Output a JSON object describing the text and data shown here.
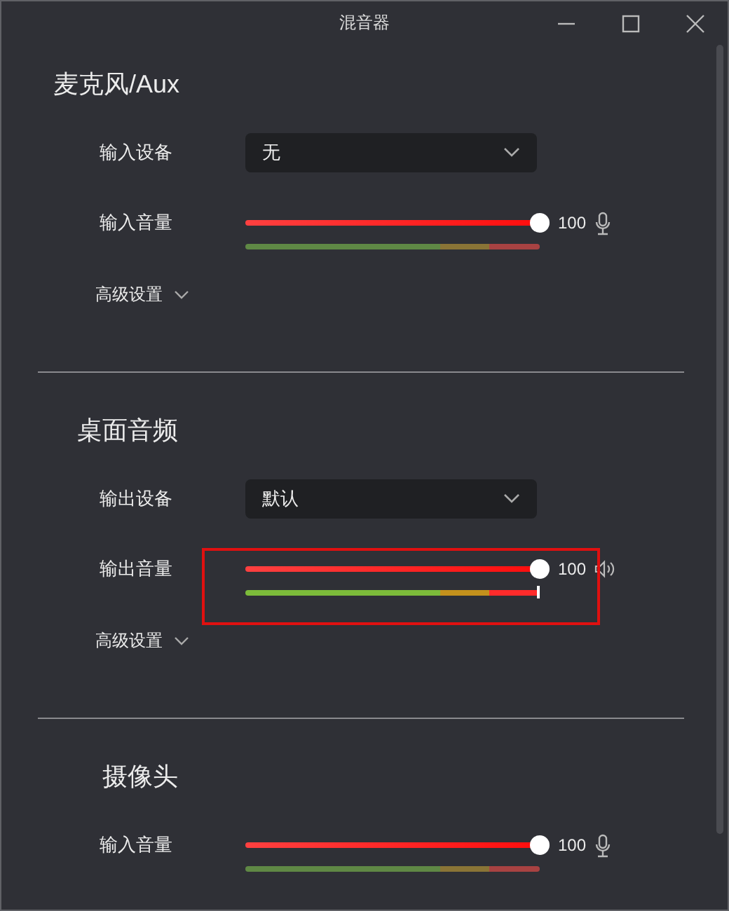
{
  "window": {
    "title": "混音器"
  },
  "sections": [
    {
      "title": "麦克风/Aux",
      "rows": [
        {
          "kind": "dropdown",
          "label": "输入设备",
          "value": "无"
        },
        {
          "kind": "input_volume",
          "label": "输入音量",
          "level": 1,
          "reading": "100",
          "meter_active": false,
          "highlighted": false
        }
      ],
      "advanced": {
        "label": "高级设置",
        "expanded": false
      }
    },
    {
      "title": "桌面音频",
      "rows": [
        {
          "kind": "dropdown",
          "label": "输出设备",
          "value": "默认"
        },
        {
          "kind": "output_volume",
          "label": "输出音量",
          "level": 1,
          "reading": "100",
          "meter_active": true,
          "highlighted": true
        }
      ],
      "advanced": {
        "label": "高级设置",
        "expanded": false
      }
    },
    {
      "title": "摄像头",
      "rows": [
        {
          "kind": "input_volume",
          "label": "输入音量",
          "level": 1,
          "reading": "100",
          "meter_active": false,
          "highlighted": false
        }
      ]
    }
  ]
}
